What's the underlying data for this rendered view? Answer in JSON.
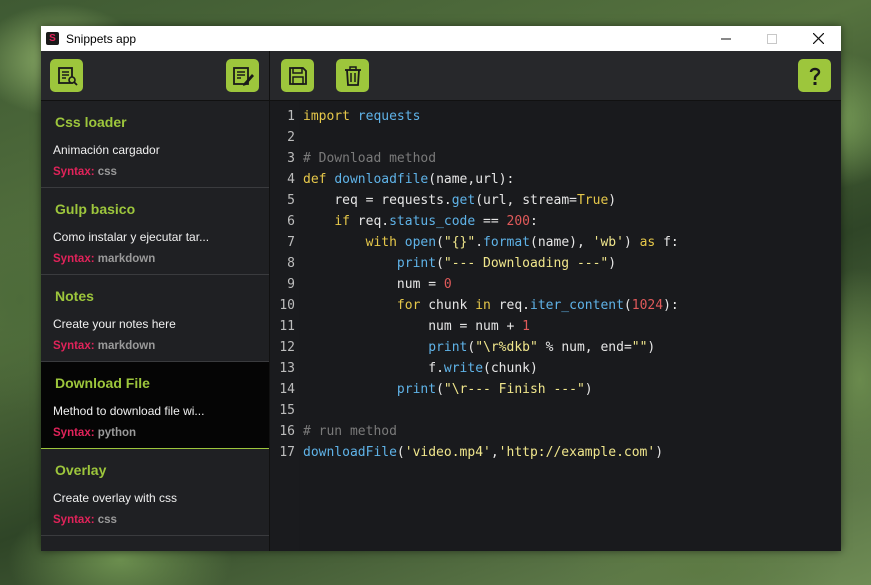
{
  "window": {
    "title": "Snippets app",
    "icon_letter": "S"
  },
  "toolbar": {
    "buttons": [
      "search-snippets",
      "new-snippet",
      "save",
      "delete",
      "help"
    ]
  },
  "colors": {
    "accent": "#9dc63c",
    "syntax_label": "#e0235a",
    "background": "#1e1f22"
  },
  "snippets": [
    {
      "title": "Css loader",
      "description": "Animación cargador",
      "syntax_label": "Syntax:",
      "syntax": "css"
    },
    {
      "title": "Gulp basico",
      "description": "Como instalar y ejecutar tar...",
      "syntax_label": "Syntax:",
      "syntax": "markdown"
    },
    {
      "title": "Notes",
      "description": "Create your notes here",
      "syntax_label": "Syntax:",
      "syntax": "markdown"
    },
    {
      "title": "Download File",
      "description": "Method to download file wi...",
      "syntax_label": "Syntax:",
      "syntax": "python"
    },
    {
      "title": "Overlay",
      "description": "Create overlay with css",
      "syntax_label": "Syntax:",
      "syntax": "css"
    }
  ],
  "editor": {
    "line_numbers": [
      "1",
      "2",
      "3",
      "4",
      "5",
      "6",
      "7",
      "8",
      "9",
      "10",
      "11",
      "12",
      "13",
      "14",
      "15",
      "16",
      "17"
    ],
    "lines": [
      "import requests",
      "",
      "# Download method",
      "def downloadfile(name,url):",
      "    req = requests.get(url, stream=True)",
      "    if req.status_code == 200:",
      "        with open(\"{}\".format(name), 'wb') as f:",
      "            print(\"--- Downloading ---\")",
      "            num = 0",
      "            for chunk in req.iter_content(1024):",
      "                num = num + 1",
      "                print(\"\\r%dkb\" % num, end=\"\")",
      "                f.write(chunk)",
      "            print(\"\\r--- Finish ---\")",
      "",
      "# run method",
      "downloadFile('video.mp4','http://example.com')"
    ]
  }
}
